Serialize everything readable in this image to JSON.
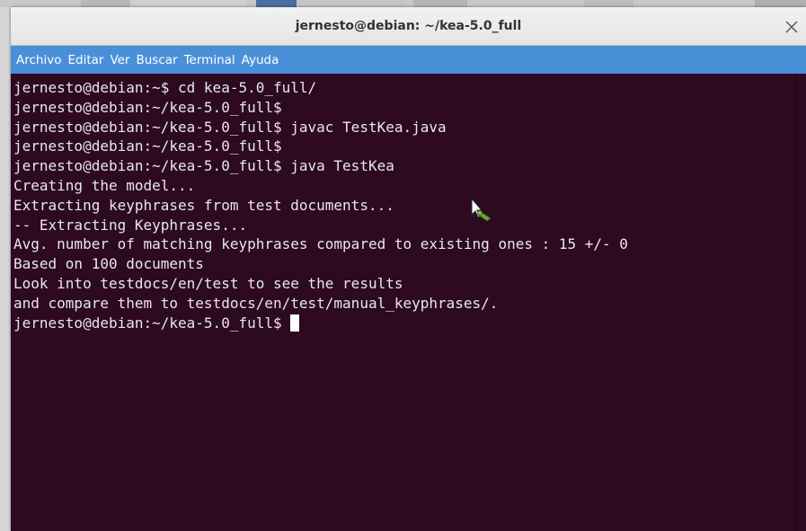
{
  "window": {
    "title": "jernesto@debian: ~/kea-5.0_full",
    "close_icon": "close-icon"
  },
  "menubar": {
    "items": [
      {
        "label": "Archivo"
      },
      {
        "label": "Editar"
      },
      {
        "label": "Ver"
      },
      {
        "label": "Buscar"
      },
      {
        "label": "Terminal"
      },
      {
        "label": "Ayuda"
      }
    ]
  },
  "terminal": {
    "lines": [
      "jernesto@debian:~$ cd kea-5.0_full/",
      "jernesto@debian:~/kea-5.0_full$",
      "jernesto@debian:~/kea-5.0_full$ javac TestKea.java",
      "jernesto@debian:~/kea-5.0_full$",
      "jernesto@debian:~/kea-5.0_full$ java TestKea",
      "Creating the model...",
      "Extracting keyphrases from test documents...",
      "-- Extracting Keyphrases...",
      "Avg. number of matching keyphrases compared to existing ones : 15 +/- 0",
      "Based on 100 documents",
      "Look into testdocs/en/test to see the results",
      "and compare them to testdocs/en/test/manual_keyphrases/."
    ],
    "prompt": "jernesto@debian:~/kea-5.0_full$ "
  },
  "colors": {
    "terminal_bg": "#2d0922",
    "menubar_bg": "#4a90d9",
    "text": "#e8e8e8"
  }
}
